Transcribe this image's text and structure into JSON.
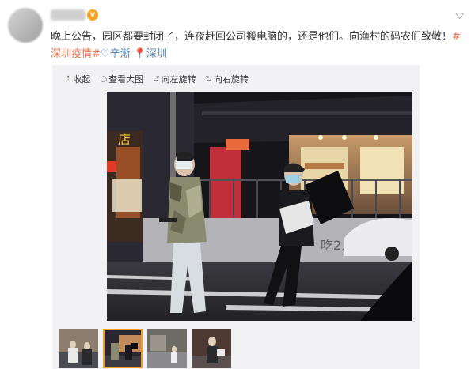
{
  "post": {
    "text_main": "晚上公告，园区都要封闭了，连夜赶回公司搬电脑的，还是他们。向渔村的码农们致敬！",
    "hashtag_1": "#深圳疫情#",
    "mention_icon": "♡",
    "mention": "辛渐",
    "location_icon": "📍",
    "location": "深圳",
    "verify_badge": "v"
  },
  "toolbar": {
    "collapse": "收起",
    "view_large": "查看大图",
    "rotate_left": "向左旋转",
    "rotate_right": "向右旋转"
  },
  "photo": {
    "shop_sign": "店",
    "wall_text": "吃2人"
  },
  "colors": {
    "accent": "#eb7350",
    "link": "#507daf",
    "verify": "#f5a623"
  }
}
